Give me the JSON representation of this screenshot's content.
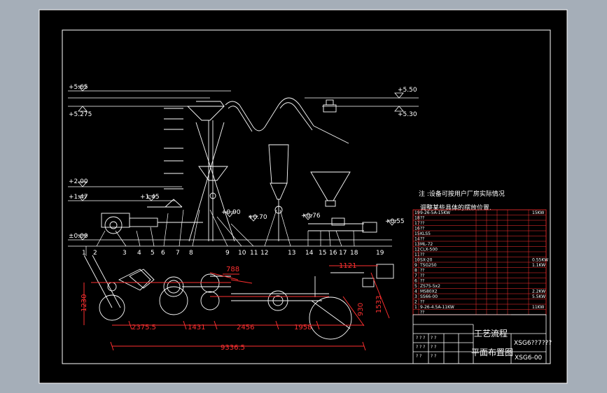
{
  "drawing": {
    "elevations": {
      "e565": "+5.65",
      "e5275": "+5.275",
      "e550": "+5.50",
      "e530": "+5.30",
      "e200": "+2.00",
      "e147": "+1.47",
      "e145": "+1.45",
      "e090": "+0.90",
      "e070": "+0.70",
      "e076": "+0.76",
      "e055": "+0.55",
      "e000": "±0.00"
    },
    "item_numbers": [
      "1",
      "2",
      "3",
      "4",
      "5",
      "6",
      "7",
      "8",
      "9",
      "10",
      "11",
      "12",
      "13",
      "14",
      "15",
      "16",
      "17",
      "18",
      "19"
    ],
    "dimensions": {
      "d788": "788",
      "d1121": "1121",
      "d1230": "1230",
      "d930": "930",
      "d1533": "1533",
      "d2375": "2375.5",
      "d1431": "1431",
      "d2456": "2456",
      "d1958": "1958",
      "d9336": "9336.5"
    },
    "note": {
      "line1": "注 :设备可按用户厂房实际情况",
      "line2": "调整某些具体的摆放位置."
    },
    "bom_rows": [
      {
        "no": "19",
        "name": "9-26-5A-15KW",
        "remark": "15KW"
      },
      {
        "no": "18",
        "name": "??",
        "remark": ""
      },
      {
        "no": "17",
        "name": "??",
        "remark": ""
      },
      {
        "no": "16",
        "name": "??",
        "remark": ""
      },
      {
        "no": "15",
        "name": "KLS5",
        "remark": ""
      },
      {
        "no": "14",
        "name": "??",
        "remark": ""
      },
      {
        "no": "13",
        "name": "ML-72",
        "remark": ""
      },
      {
        "no": "12",
        "name": "CLX-500",
        "remark": ""
      },
      {
        "no": "11",
        "name": "??",
        "remark": ""
      },
      {
        "no": "10",
        "name": "SX-20",
        "remark": "0.55KW"
      },
      {
        "no": "9",
        "name": "TSG250",
        "remark": "1.1KW"
      },
      {
        "no": "8",
        "name": "??",
        "remark": ""
      },
      {
        "no": "7",
        "name": "??",
        "remark": ""
      },
      {
        "no": "6",
        "name": "??",
        "remark": ""
      },
      {
        "no": "5",
        "name": "ZS75-5x2",
        "remark": ""
      },
      {
        "no": "4",
        "name": "MS80X2",
        "remark": "2.2KW"
      },
      {
        "no": "3",
        "name": "SS66-00",
        "remark": "5.5KW"
      },
      {
        "no": "2",
        "name": "??",
        "remark": ""
      },
      {
        "no": "1",
        "name": "9-26-4.5A-11KW",
        "remark": "11KW"
      },
      {
        "no": "",
        "name": "??",
        "remark": ""
      }
    ],
    "title_block": {
      "title1": "工艺流程",
      "title2": "平面布置图",
      "code1": "XSG6??7???",
      "code2": "XSG6-00"
    }
  }
}
